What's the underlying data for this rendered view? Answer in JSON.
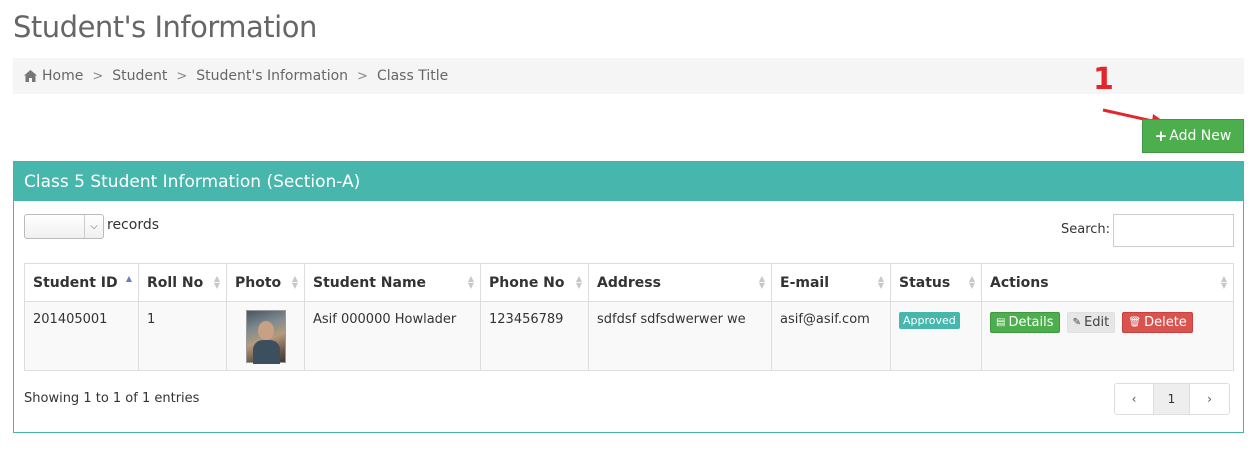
{
  "page_title": "Student's Information",
  "breadcrumb": [
    "Home",
    "Student",
    "Student's Information",
    "Class Title"
  ],
  "annotation": {
    "number": "1"
  },
  "add_button": {
    "label": "Add New"
  },
  "panel": {
    "title": "Class 5 Student Information (Section-A)"
  },
  "table_controls": {
    "records_label": "records",
    "length_selected": "",
    "search_label": "Search:",
    "search_value": ""
  },
  "table": {
    "columns": [
      "Student ID",
      "Roll No",
      "Photo",
      "Student Name",
      "Phone No",
      "Address",
      "E-mail",
      "Status",
      "Actions"
    ],
    "rows": [
      {
        "student_id": "201405001",
        "roll_no": "1",
        "student_name": "Asif 000000 Howlader",
        "phone_no": "123456789",
        "address": "sdfdsf sdfsdwerwer we",
        "email": "asif@asif.com",
        "status": "Approved",
        "actions": {
          "details": "Details",
          "edit": "Edit",
          "delete": "Delete"
        }
      }
    ]
  },
  "footer": {
    "info": "Showing 1 to 1 of 1 entries",
    "pagination": {
      "prev": "‹",
      "current": "1",
      "next": "›"
    }
  },
  "colors": {
    "accent": "#47b7ae",
    "success": "#4cae4c",
    "danger": "#d9534f",
    "annotation": "#e3262b"
  }
}
